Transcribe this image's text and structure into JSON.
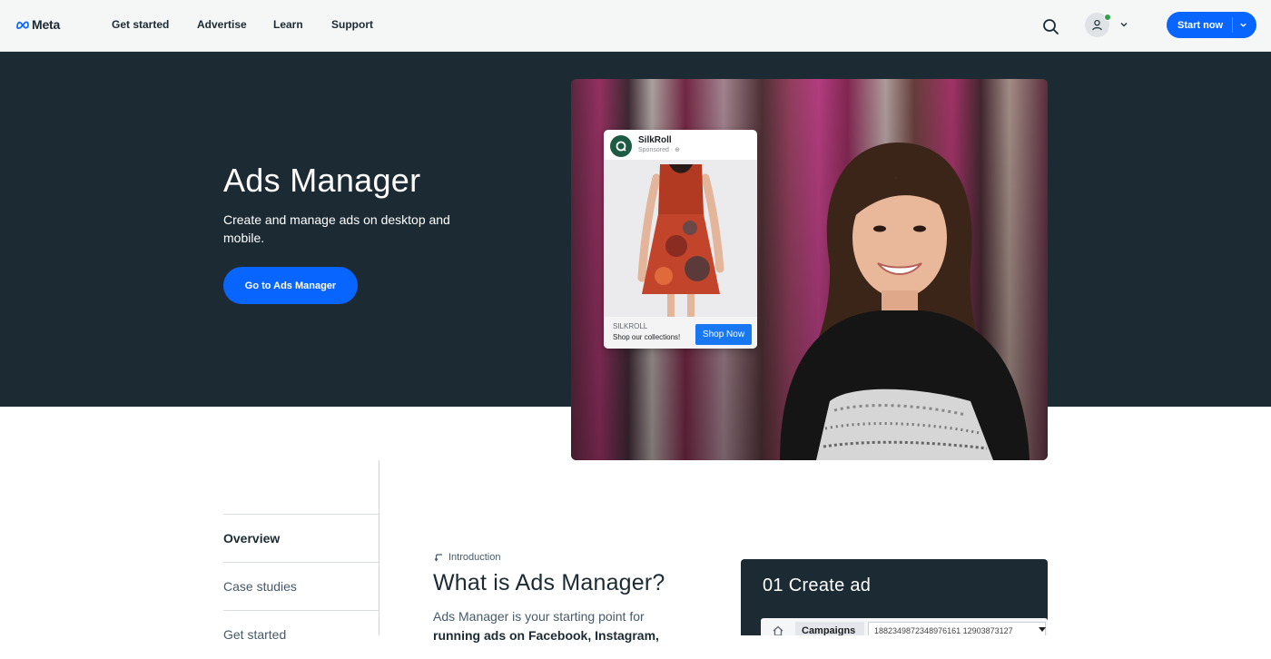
{
  "nav": {
    "logo_text": "Meta",
    "links": [
      "Get started",
      "Advertise",
      "Learn",
      "Support"
    ],
    "start_label": "Start now"
  },
  "hero": {
    "title": "Ads Manager",
    "subtitle": "Create and manage ads on desktop and mobile.",
    "cta_label": "Go to Ads Manager"
  },
  "ad_preview": {
    "brand": "SilkRoll",
    "sponsored": "Sponsored ·",
    "footer_name": "SILKROLL",
    "footer_text": "Shop our collections!",
    "shop_label": "Shop Now"
  },
  "side_nav": {
    "items": [
      "Overview",
      "Case studies",
      "Get started"
    ],
    "active": "Overview"
  },
  "intro": {
    "tag": "Introduction",
    "title": "What is Ads Manager?",
    "body_plain": "Ads Manager is your starting point for",
    "body_bold": "running ads on Facebook, Instagram,"
  },
  "create_panel": {
    "title": "01 Create ad",
    "campaigns_label": "Campaigns",
    "campaign_id": "1882349872348976161 12903873127"
  },
  "colors": {
    "brand_blue": "#0866ff",
    "hero_bg": "#1c2b33",
    "status_green": "#31a24c"
  },
  "icons": [
    "meta-logo-icon",
    "search-icon",
    "user-icon",
    "chevron-down-icon",
    "arrow-return-icon",
    "home-icon"
  ]
}
